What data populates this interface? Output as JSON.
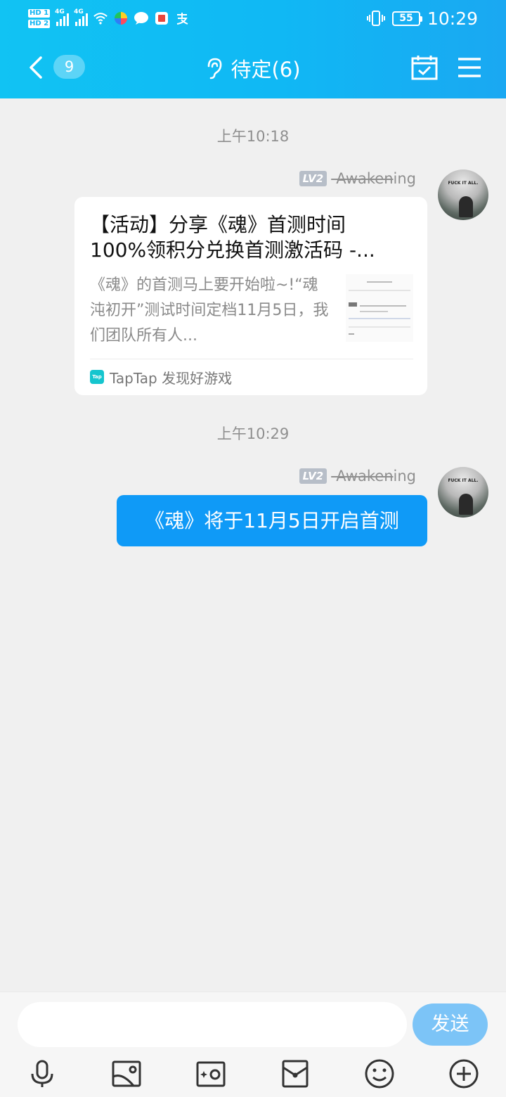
{
  "statusbar": {
    "hd1": "HD 1",
    "hd2": "HD 2",
    "net1": "4G",
    "net2": "4G",
    "time": "10:29",
    "battery": "55"
  },
  "nav": {
    "unread_count": "9",
    "title": "待定(6)"
  },
  "messages": [
    {
      "time": "上午10:18",
      "level": "LV2",
      "sender_struck": "-Awaken",
      "sender_rest": "ing",
      "card": {
        "title": "【活动】分享《魂》首测时间100%领积分兑换首测激活码 -...",
        "desc": "《魂》的首测马上要开始啦~!“魂沌初开”测试时间定档11月5日，我们团队所有人...",
        "source": "TapTap 发现好游戏",
        "source_logo": "Tap"
      }
    },
    {
      "time": "上午10:29",
      "level": "LV2",
      "sender_struck": "-Awaken",
      "sender_rest": "ing",
      "text": "《魂》将于11月5日开启首测"
    }
  ],
  "avatar_text": "FUCK IT ALL.",
  "composer": {
    "send_label": "发送",
    "tools": [
      "microphone-icon",
      "image-icon",
      "camera-icon",
      "red-packet-icon",
      "emoji-icon",
      "plus-icon"
    ]
  }
}
